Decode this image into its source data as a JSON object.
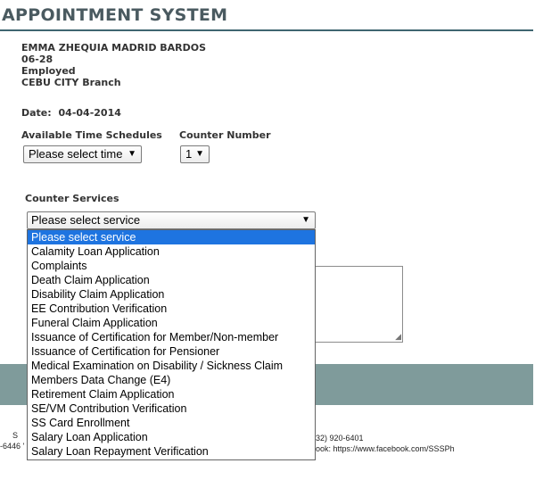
{
  "header": {
    "title": "APPOINTMENT SYSTEM"
  },
  "member": {
    "name": "EMMA ZHEQUIA MADRID BARDOS",
    "code": "06-28",
    "status": "Employed",
    "branch": "CEBU CITY Branch"
  },
  "date": {
    "label": "Date:",
    "value": "04-04-2014"
  },
  "schedule": {
    "label": "Available Time Schedules",
    "selected": "Please select time"
  },
  "counter": {
    "label": "Counter Number",
    "selected": "1"
  },
  "services": {
    "label": "Counter Services",
    "selected": "Please select service",
    "options": [
      "Please select service",
      "Calamity Loan Application",
      "Complaints",
      "Death Claim Application",
      "Disability Claim Application",
      "EE Contribution Verification",
      "Funeral Claim Application",
      "Issuance of Certification for Member/Non-member",
      "Issuance of Certification for Pensioner",
      "Medical Examination on Disability / Sickness Claim",
      "Members Data Change (E4)",
      "Retirement Claim Application",
      "SE/VM Contribution Verification",
      "SS Card Enrollment",
      "Salary Loan Application",
      "Salary Loan Repayment Verification"
    ]
  },
  "footer": {
    "left_fragment": "-6446 '",
    "s_fragment": "S",
    "phone_fragment": "32) 920-6401",
    "facebook_fragment": "ook: https://www.facebook.com/SSSPh"
  },
  "colors": {
    "accent": "#3f6670",
    "band": "#7f9b9b",
    "highlight": "#1e74e0"
  }
}
